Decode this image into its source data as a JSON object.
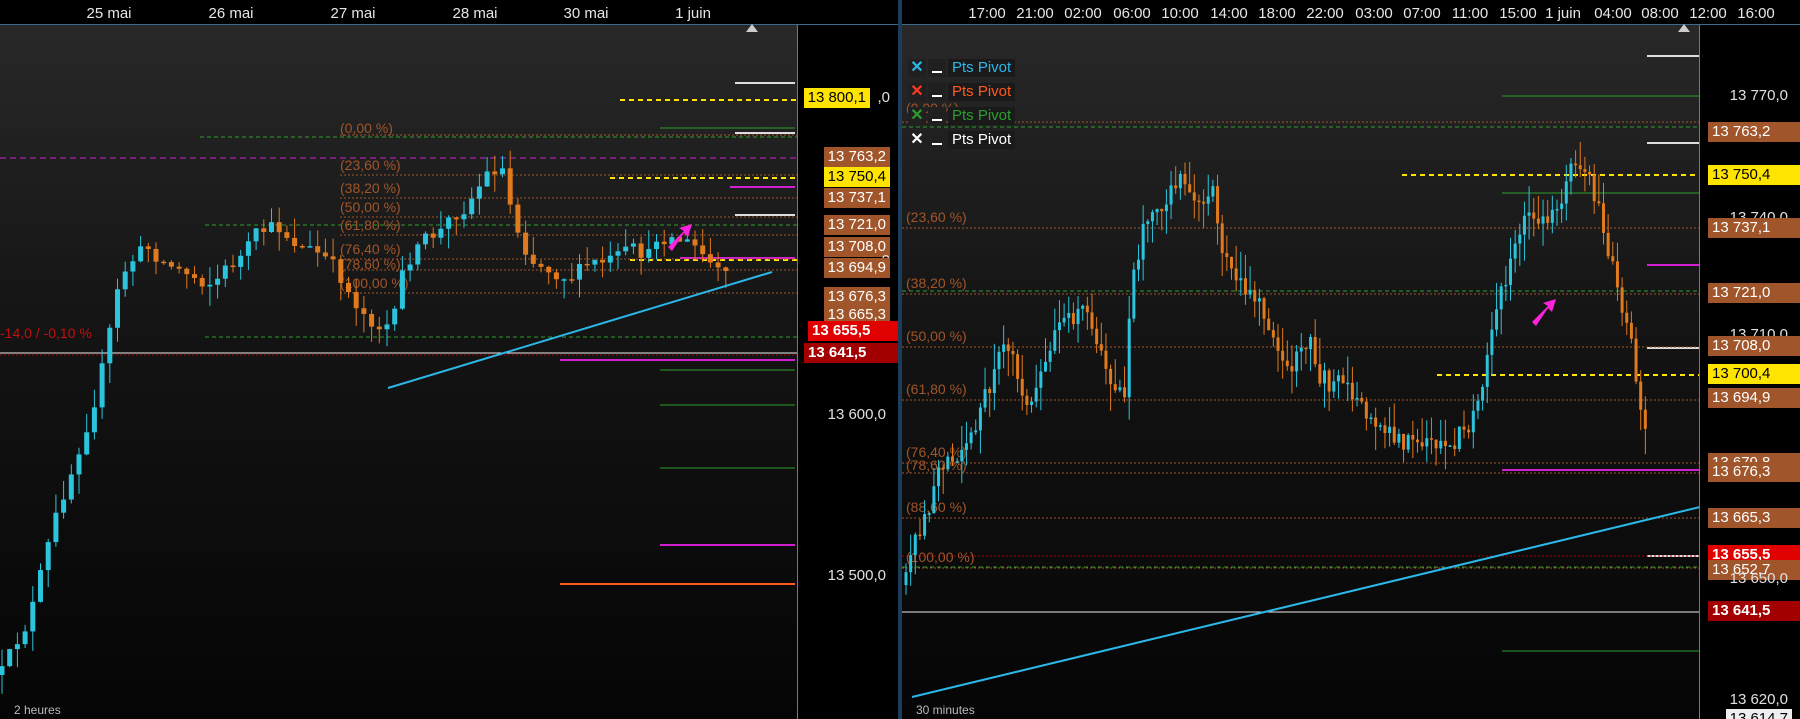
{
  "left": {
    "timeframe": "2 heures",
    "time_labels": [
      "25 mai",
      "26 mai",
      "27 mai",
      "28 mai",
      "30 mai",
      "1 juin"
    ],
    "price_tags": [
      {
        "text": "13 800,1",
        "style": "yellow"
      },
      {
        "text": ",0",
        "style": "plain"
      },
      {
        "text": "13 763,2",
        "style": "orange"
      },
      {
        "text": "13 750,4",
        "style": "yellow"
      },
      {
        "text": "13 737,1",
        "style": "orange"
      },
      {
        "text": "13 721,0",
        "style": "orange"
      },
      {
        "text": "13 708,0",
        "style": "orange"
      },
      {
        "text": ",0",
        "style": "plain"
      },
      {
        "text": "13 694,9",
        "style": "orange"
      },
      {
        "text": "13 676,3",
        "style": "orange"
      },
      {
        "text": "13 665,3",
        "style": "orange"
      },
      {
        "text": "13 655,5",
        "style": "red"
      },
      {
        "text": "13 641,5",
        "style": "darkred"
      },
      {
        "text": "13 600,0",
        "style": "plain"
      },
      {
        "text": "13 500,0",
        "style": "plain"
      }
    ],
    "fib_labels": [
      "(0,00 %)",
      "(23,60 %)",
      "(38,20 %)",
      "(50,00 %)",
      "(61,80 %)",
      "(76,40 %)",
      "(78,60 %)",
      "(100,00 %)"
    ],
    "left_edge_label": "-14,0 / -0,10 %"
  },
  "right": {
    "timeframe": "30 minutes",
    "time_labels": [
      "17:00",
      "21:00",
      "02:00",
      "06:00",
      "10:00",
      "14:00",
      "18:00",
      "22:00",
      "03:00",
      "07:00",
      "11:00",
      "15:00",
      "1 juin",
      "04:00",
      "08:00",
      "12:00",
      "16:00"
    ],
    "legend": [
      {
        "label": "Pts Pivot",
        "color": "#2bb8e8",
        "x_color": "#2bb8e8"
      },
      {
        "label": "Pts Pivot",
        "color": "#ff5a1f",
        "x_color": "#ff3a1f"
      },
      {
        "label": "Pts Pivot",
        "color": "#2d9e2d",
        "x_color": "#2d9e2d"
      },
      {
        "label": "Pts Pivot",
        "color": "#ffffff",
        "x_color": "#ffffff"
      }
    ],
    "price_tags": [
      {
        "text": "13 770,0",
        "style": "plain"
      },
      {
        "text": "13 763,2",
        "style": "orange"
      },
      {
        "text": "13 750,4",
        "style": "yellow"
      },
      {
        "text": "13 740,0",
        "style": "plain"
      },
      {
        "text": "13 737,1",
        "style": "orange"
      },
      {
        "text": "13 721,0",
        "style": "orange"
      },
      {
        "text": "13 710,0",
        "style": "plain"
      },
      {
        "text": "13 708,0",
        "style": "orange"
      },
      {
        "text": "13 700,4",
        "style": "yellow"
      },
      {
        "text": "13 694,9",
        "style": "orange"
      },
      {
        "text": "13 679,8",
        "style": "orange"
      },
      {
        "text": "13 676,3",
        "style": "orange"
      },
      {
        "text": "13 665,3",
        "style": "orange"
      },
      {
        "text": "13 655,5",
        "style": "red"
      },
      {
        "text": "13 652,7",
        "style": "orange"
      },
      {
        "text": "13 650,0",
        "style": "plain"
      },
      {
        "text": "13 641,5",
        "style": "darkred"
      },
      {
        "text": "13 620,0",
        "style": "plain"
      },
      {
        "text": "13 614,7",
        "style": "plain"
      }
    ],
    "fib_labels": [
      "(0,00 %)",
      "(23,60 %)",
      "(38,20 %)",
      "(50,00 %)",
      "(61,80 %)",
      "(76,40 %)",
      "(78,60 %)",
      "(88,60 %)",
      "(100,00 %)"
    ]
  },
  "colors": {
    "bull": "#2bc4dc",
    "bear": "#e07a1f",
    "fib": "#a0552a",
    "pivot_green": "#2d9e2d",
    "pivot_magenta": "#d020d0",
    "pivot_yellow": "#ffe400",
    "trend": "#2bb8e8"
  }
}
